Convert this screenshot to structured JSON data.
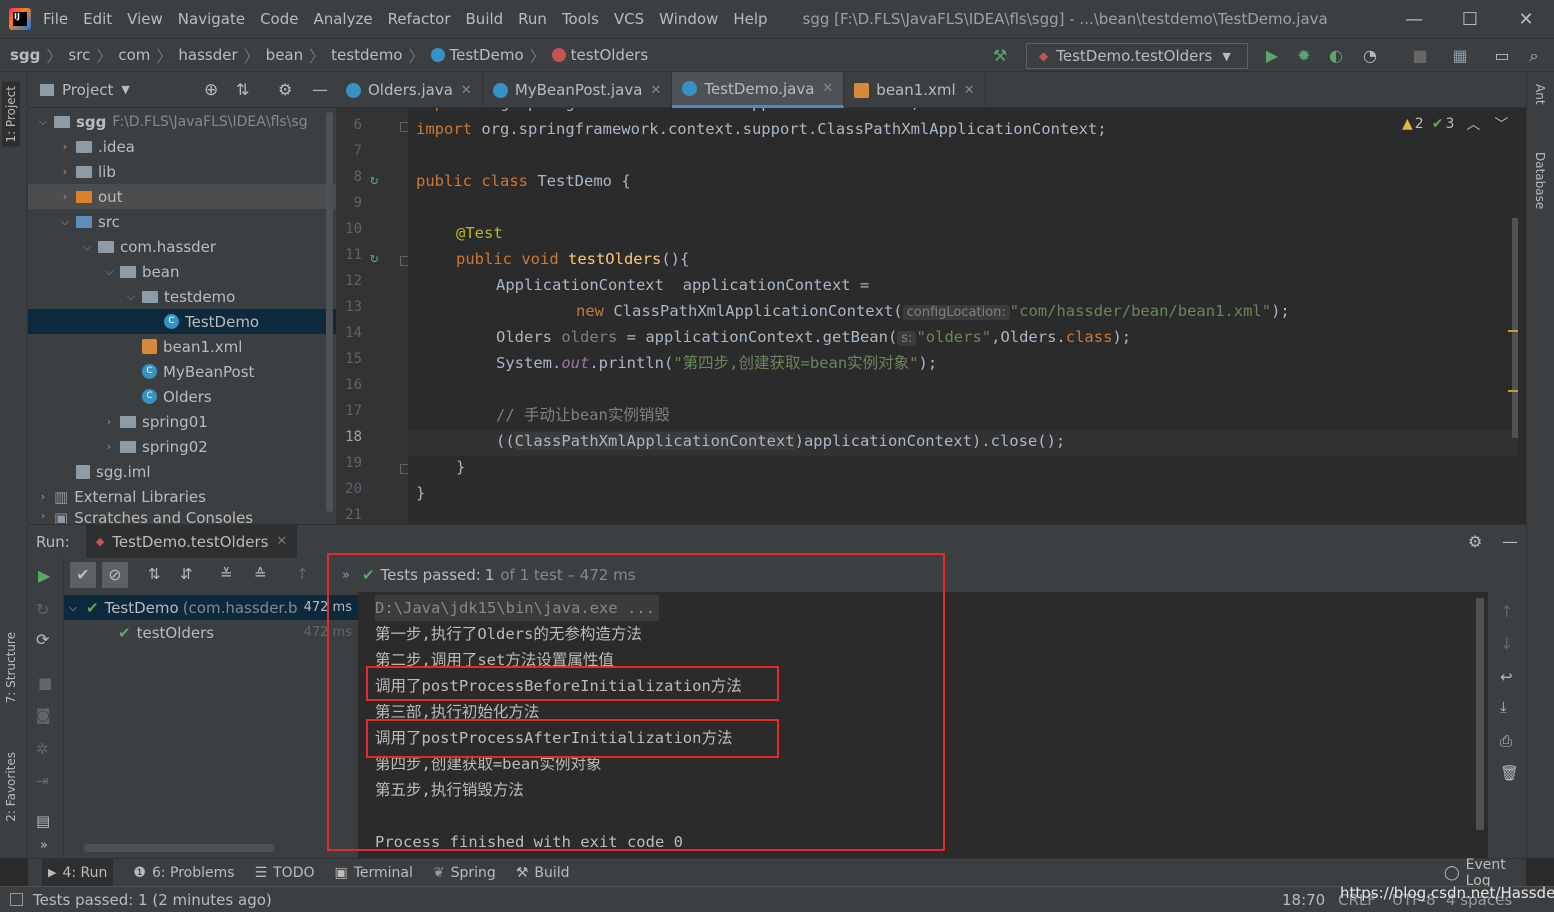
{
  "window": {
    "title": "sgg [F:\\D.FLS\\JavaFLS\\IDEA\\fls\\sgg] - ...\\bean\\testdemo\\TestDemo.java",
    "menu": [
      "File",
      "Edit",
      "View",
      "Navigate",
      "Code",
      "Analyze",
      "Refactor",
      "Build",
      "Run",
      "Tools",
      "VCS",
      "Window",
      "Help"
    ]
  },
  "breadcrumb": [
    "sgg",
    "src",
    "com",
    "hassder",
    "bean",
    "testdemo",
    "TestDemo",
    "testOlders"
  ],
  "run_config": "TestDemo.testOlders",
  "left_strip": {
    "project_tab": "1: Project",
    "structure_tab": "7: Structure",
    "favorites_tab": "2: Favorites"
  },
  "right_strip": {
    "ant_tab": "Ant",
    "database_tab": "Database"
  },
  "project": {
    "title": "Project",
    "tree": [
      {
        "label": "sgg",
        "extra": "F:\\D.FLS\\JavaFLS\\IDEA\\fls\\sg"
      },
      {
        "label": ".idea"
      },
      {
        "label": "lib"
      },
      {
        "label": "out"
      },
      {
        "label": "src"
      },
      {
        "label": "com.hassder"
      },
      {
        "label": "bean"
      },
      {
        "label": "testdemo"
      },
      {
        "label": "TestDemo"
      },
      {
        "label": "bean1.xml"
      },
      {
        "label": "MyBeanPost"
      },
      {
        "label": "Olders"
      },
      {
        "label": "spring01"
      },
      {
        "label": "spring02"
      },
      {
        "label": "sgg.iml"
      },
      {
        "label": "External Libraries"
      },
      {
        "label": "Scratches and Consoles"
      }
    ]
  },
  "editor": {
    "tabs": [
      "Olders.java",
      "MyBeanPost.java",
      "TestDemo.java",
      "bean1.xml"
    ],
    "active_tab": "TestDemo.java",
    "warnings": "2",
    "weak_warnings": "3",
    "line_numbers": [
      "6",
      "7",
      "8",
      "9",
      "10",
      "11",
      "12",
      "13",
      "14",
      "15",
      "16",
      "17",
      "18",
      "19",
      "20",
      "21"
    ],
    "code": {
      "l6a": "import ",
      "l6b": "org.springframework.context.support.ClassPathXmlApplicationContext;",
      "l8a": "public class ",
      "l8b": "TestDemo {",
      "l10": "@Test",
      "l11a": "public void ",
      "l11b": "testOlders",
      "l11c": "(){",
      "l12": "ApplicationContext  applicationContext =",
      "l13a": "new ",
      "l13b": "ClassPathXmlApplicationContext(",
      "l13hint": "configLocation:",
      "l13s": "\"com/hassder/bean/bean1.xml\"",
      "l13c": ");",
      "l14a": "Olders ",
      "l14b": "olders",
      "l14c": " = applicationContext.getBean(",
      "l14hint": "s:",
      "l14s": "\"olders\"",
      "l14d": ",Olders.",
      "l14e": "class",
      "l14f": ");",
      "l15a": "System.",
      "l15b": "out",
      "l15c": ".println(",
      "l15s": "\"第四步,创建获取=bean实例对象\"",
      "l15d": ");",
      "l17": "// 手动让bean实例销毁",
      "l18a": "((",
      "l18b": "ClassPathXmlApplicationContext",
      "l18c": ")applicationContext).close();",
      "l19": "}",
      "l20": "}"
    }
  },
  "run": {
    "label": "Run:",
    "tab": "TestDemo.testOlders",
    "status_prefix": "Tests passed:",
    "status_count": "1",
    "status_suffix": "of 1 test – 472 ms",
    "tree": [
      {
        "label": "TestDemo",
        "detail": "(com.hassder.b",
        "time": "472 ms"
      },
      {
        "label": "testOlders",
        "time": "472 ms"
      }
    ],
    "console": [
      "D:\\Java\\jdk15\\bin\\java.exe ...",
      "第一步,执行了Olders的无参构造方法",
      "第二步,调用了set方法设置属性值",
      "调用了postProcessBeforeInitialization方法",
      "第三部,执行初始化方法",
      "调用了postProcessAfterInitialization方法",
      "第四步,创建获取=bean实例对象",
      "第五步,执行销毁方法",
      "",
      "Process finished with exit code 0"
    ]
  },
  "bottom_tabs": [
    "4: Run",
    "6: Problems",
    "TODO",
    "Terminal",
    "Spring",
    "Build"
  ],
  "event_log": "Event Log",
  "status": {
    "message": "Tests passed: 1 (2 minutes ago)",
    "position": "18:70",
    "line_sep": "CRLF",
    "encoding": "UTF-8",
    "indent": "4 spaces",
    "watermark": "https://blog.csdn.net/Hassder"
  }
}
